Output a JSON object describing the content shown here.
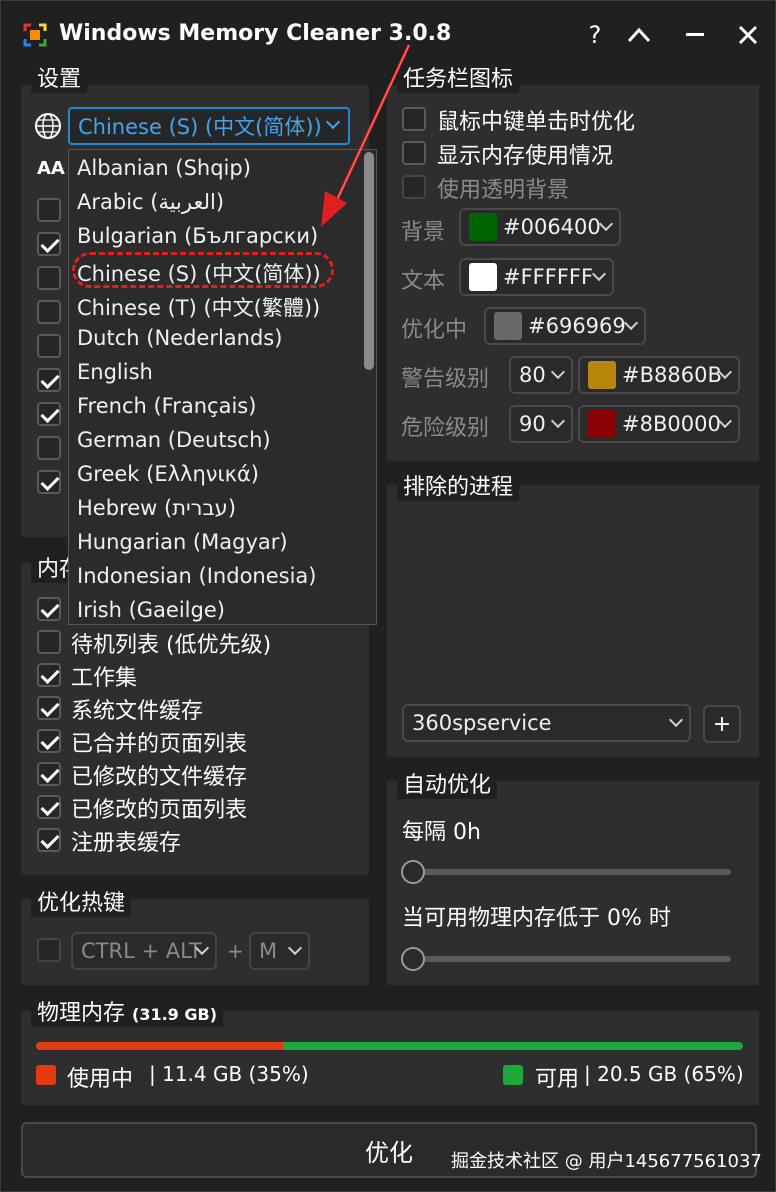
{
  "window": {
    "title": "Windows Memory Cleaner 3.0.8",
    "help": "?",
    "collapse": "︿",
    "minimize": "—",
    "close": "✕"
  },
  "settings": {
    "header": "设置",
    "language_selected": "Chinese (S) (中文(简体))",
    "font_icon": "AA",
    "checkbox_states": [
      false,
      true,
      false,
      false,
      false,
      true,
      true,
      false,
      true
    ]
  },
  "language_list": [
    "Albanian (Shqip)",
    "Arabic (العربية)",
    "Bulgarian (Български)",
    "Chinese (S) (中文(简体))",
    "Chinese (T) (中文(繁體))",
    "Dutch (Nederlands)",
    "English",
    "French (Français)",
    "German (Deutsch)",
    "Greek (Ελληνικά)",
    "Hebrew (עברית)",
    "Hungarian (Magyar)",
    "Indonesian (Indonesia)",
    "Irish (Gaeilge)"
  ],
  "memory_areas": {
    "header": "内存",
    "items": [
      {
        "label": "",
        "checked": true
      },
      {
        "label": "待机列表 (低优先级)",
        "checked": false
      },
      {
        "label": "工作集",
        "checked": true
      },
      {
        "label": "系统文件缓存",
        "checked": true
      },
      {
        "label": "已合并的页面列表",
        "checked": true
      },
      {
        "label": "已修改的文件缓存",
        "checked": true
      },
      {
        "label": "已修改的页面列表",
        "checked": true
      },
      {
        "label": "注册表缓存",
        "checked": true
      }
    ]
  },
  "hotkey": {
    "header": "优化热键",
    "modifier": "CTRL + ALT",
    "plus": "+",
    "key": "M"
  },
  "tray": {
    "header": "任务栏图标",
    "middle_click": "鼠标中键单击时优化",
    "show_usage": "显示内存使用情况",
    "transparent": "使用透明背景",
    "background_label": "背景",
    "background_color": "#006400",
    "text_label": "文本",
    "text_color": "#FFFFFF",
    "optimizing_label": "优化中",
    "optimizing_color": "#696969",
    "warning_label": "警告级别",
    "warning_level": "80",
    "warning_color": "#B8860B",
    "danger_label": "危险级别",
    "danger_level": "90",
    "danger_color": "#8B0000"
  },
  "excluded": {
    "header": "排除的进程",
    "process": "360spservice",
    "add": "+"
  },
  "auto": {
    "header": "自动优化",
    "interval": "每隔 0h",
    "interval_value": 0,
    "threshold": "当可用物理内存低于 0% 时",
    "threshold_value": 0
  },
  "memory": {
    "header": "物理内存",
    "total": "(31.9 GB)",
    "used_label": "使用中",
    "used_value": "| 11.4 GB (35%)",
    "used_fraction": 0.35,
    "free_label": "可用",
    "free_value": "| 20.5 GB (65%)",
    "used_color": "#E23B12",
    "free_color": "#1FA83A"
  },
  "optimize_button": "优化",
  "watermark": "掘金技术社区 @ 用户145677561037"
}
